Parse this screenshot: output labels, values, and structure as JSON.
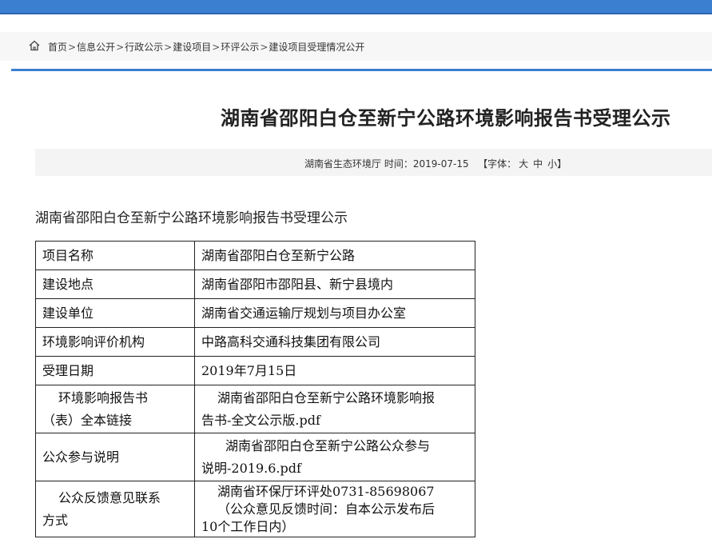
{
  "breadcrumb": {
    "items": [
      "首页",
      "信息公开",
      "行政公示",
      "建设项目",
      "环评公示",
      "建设项目受理情况公开"
    ],
    "separator": ">"
  },
  "article": {
    "title": "湖南省邵阳白仓至新宁公路环境影响报告书受理公示",
    "source": "湖南省生态环境厅",
    "time_label": "时间：",
    "date": "2019-07-15",
    "font_label": "【字体：",
    "font_large": "大",
    "font_medium": "中",
    "font_small": "小】",
    "subtitle": "湖南省邵阳白仓至新宁公路环境影响报告书受理公示"
  },
  "table": {
    "rows": [
      {
        "key": "项目名称",
        "value": "湖南省邵阳白仓至新宁公路"
      },
      {
        "key": "建设地点",
        "value": "湖南省邵阳市邵阳县、新宁县境内"
      },
      {
        "key": "建设单位",
        "value": "湖南省交通运输厅规划与项目办公室"
      },
      {
        "key": "环境影响评价机构",
        "value": "中路高科交通科技集团有限公司"
      },
      {
        "key": "受理日期",
        "value": "2019年7月15日"
      },
      {
        "key_l1": "环境影响报告书",
        "key_l2": "（表）全本链接",
        "value_l1": "湖南省邵阳白仓至新宁公路环境影响报",
        "value_l2": "告书-全文公示版.pdf"
      },
      {
        "key": "公众参与说明",
        "value_l1": "湖南省邵阳白仓至新宁公路公众参与",
        "value_l2": "说明-2019.6.pdf"
      },
      {
        "key_l1": "公众反馈意见联系",
        "key_l2": "方式",
        "value_l1": "湖南省环保厅环评处0731-85698067",
        "value_l2": "（公众意见反馈时间：自本公示发布后",
        "value_l3": "10个工作日内）"
      }
    ]
  },
  "colors": {
    "accent": "#3b7fd1",
    "meta_bg": "#f4f4f4"
  }
}
